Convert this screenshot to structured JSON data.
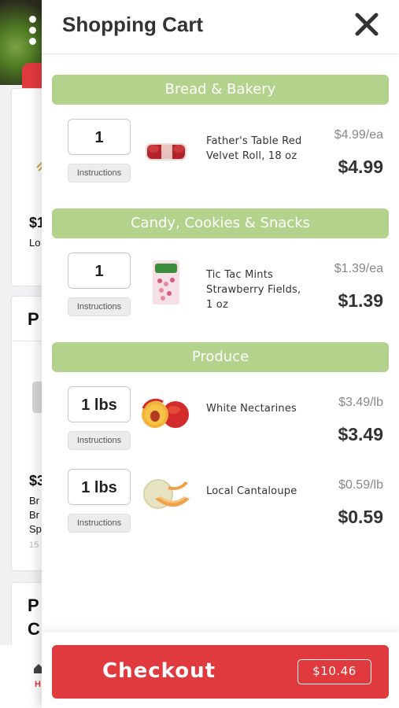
{
  "background": {
    "card1": {
      "price": "$1",
      "text": "Lo"
    },
    "card2": {
      "heading": "P",
      "price": "$3",
      "lines": [
        "Br",
        "Br",
        "Sp"
      ],
      "small": "15"
    },
    "card3": {
      "heading_lines": [
        "P",
        "C"
      ]
    },
    "bottom_nav": {
      "label": "H"
    }
  },
  "cart": {
    "title": "Shopping Cart",
    "close_icon": "close-icon",
    "instructions_label": "Instructions",
    "sections": [
      {
        "name": "Bread & Bakery",
        "items": [
          {
            "qty": "1",
            "name": "Father's Table Red Velvet Roll, 18 oz",
            "unit_price": "$4.99/ea",
            "price": "$4.99",
            "image": "red-velvet-roll"
          }
        ]
      },
      {
        "name": "Candy, Cookies & Snacks",
        "items": [
          {
            "qty": "1",
            "name": "Tic Tac Mints Strawberry Fields, 1 oz",
            "unit_price": "$1.39/ea",
            "price": "$1.39",
            "image": "tic-tac-pack"
          }
        ]
      },
      {
        "name": "Produce",
        "items": [
          {
            "qty": "1 lbs",
            "name": "White Nectarines",
            "unit_price": "$3.49/lb",
            "price": "$3.49",
            "image": "nectarines"
          },
          {
            "qty": "1 lbs",
            "name": "Local Cantaloupe",
            "unit_price": "$0.59/lb",
            "price": "$0.59",
            "image": "cantaloupe"
          }
        ]
      }
    ],
    "checkout": {
      "label": "Checkout",
      "total": "$10.46"
    }
  },
  "colors": {
    "section_header": "#b3d28b",
    "checkout_red": "#e0393e",
    "text_dark": "#333333",
    "text_muted": "#888888"
  }
}
